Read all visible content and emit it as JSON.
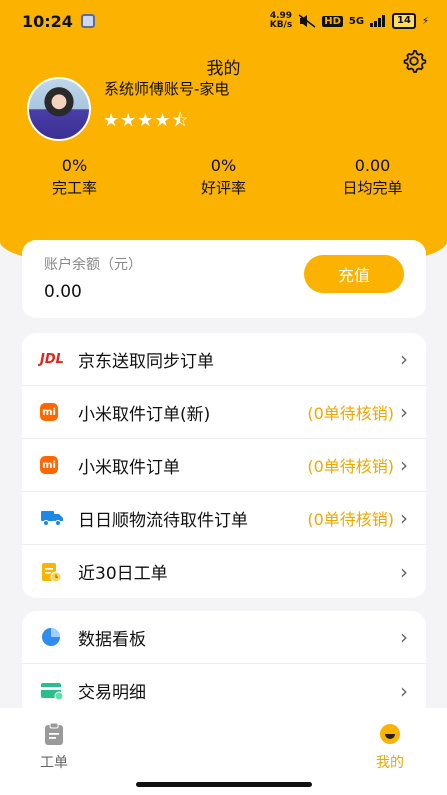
{
  "status_bar": {
    "time": "10:24",
    "net_speed_top": "4.99",
    "net_speed_bottom": "KB/s",
    "hd": "HD",
    "signal": "5G",
    "battery": "14"
  },
  "header": {
    "title": "我的",
    "account_name": "系统师傅账号-家电",
    "rating_stars": "★★★★⯪",
    "rating_value": 4.5,
    "accent_color": "#fbb200"
  },
  "stats": [
    {
      "value": "0%",
      "label": "完工率"
    },
    {
      "value": "0%",
      "label": "好评率"
    },
    {
      "value": "0.00",
      "label": "日均完单"
    }
  ],
  "balance": {
    "label": "账户余额（元）",
    "amount": "0.00",
    "recharge_label": "充值"
  },
  "orders": [
    {
      "icon": "jdl-logo-icon",
      "logo_text": "JDL",
      "label": "京东送取同步订单",
      "pending": ""
    },
    {
      "icon": "xiaomi-logo-icon",
      "logo_text": "mi",
      "label": "小米取件订单(新)",
      "pending": "(0单待核销)"
    },
    {
      "icon": "xiaomi-logo-icon",
      "logo_text": "mi",
      "label": "小米取件订单",
      "pending": "(0单待核销)"
    },
    {
      "icon": "truck-icon",
      "label": "日日顺物流待取件订单",
      "pending": "(0单待核销)"
    },
    {
      "icon": "clipboard-clock-icon",
      "label": "近30日工单",
      "pending": ""
    }
  ],
  "tools": [
    {
      "icon": "pie-chart-icon",
      "label": "数据看板"
    },
    {
      "icon": "card-icon",
      "label": "交易明细"
    }
  ],
  "tabbar": {
    "work_orders": "工单",
    "mine": "我的"
  },
  "chevron": "›"
}
